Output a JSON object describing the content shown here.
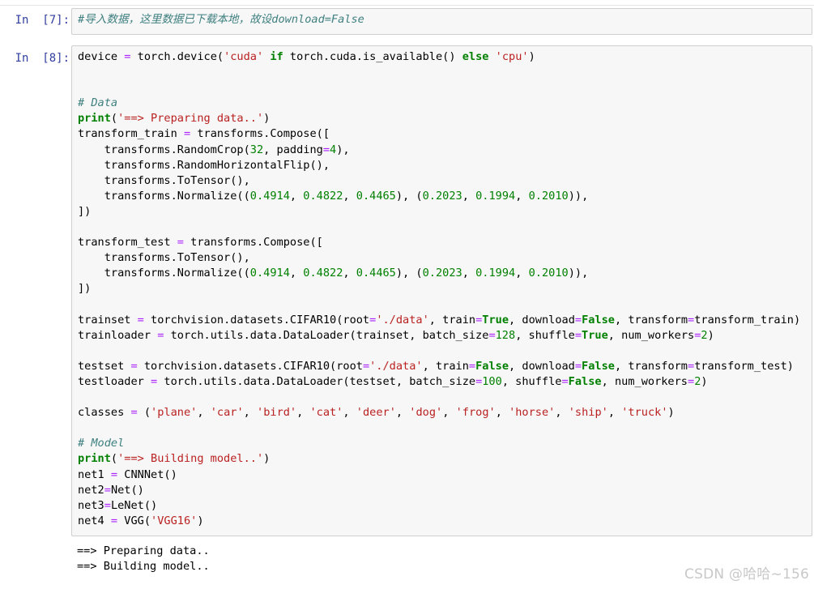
{
  "cells": [
    {
      "prompt": "In  [7]:",
      "lines": [
        [
          {
            "t": "#导入数据，这里数据已下载本地，故设download=False",
            "c": "com"
          }
        ]
      ]
    },
    {
      "prompt": "In  [8]:",
      "lines": [
        [
          {
            "t": "device ",
            "c": "plain"
          },
          {
            "t": "=",
            "c": "op"
          },
          {
            "t": " torch.device(",
            "c": "plain"
          },
          {
            "t": "'cuda'",
            "c": "str"
          },
          {
            "t": " ",
            "c": "plain"
          },
          {
            "t": "if",
            "c": "kw"
          },
          {
            "t": " torch.cuda.is_available() ",
            "c": "plain"
          },
          {
            "t": "else",
            "c": "kw"
          },
          {
            "t": " ",
            "c": "plain"
          },
          {
            "t": "'cpu'",
            "c": "str"
          },
          {
            "t": ")",
            "c": "plain"
          }
        ],
        [],
        [],
        [
          {
            "t": "# Data",
            "c": "com"
          }
        ],
        [
          {
            "t": "print",
            "c": "kw"
          },
          {
            "t": "(",
            "c": "plain"
          },
          {
            "t": "'==> Preparing data..'",
            "c": "str"
          },
          {
            "t": ")",
            "c": "plain"
          }
        ],
        [
          {
            "t": "transform_train ",
            "c": "plain"
          },
          {
            "t": "=",
            "c": "op"
          },
          {
            "t": " transforms.Compose([",
            "c": "plain"
          }
        ],
        [
          {
            "t": "    transforms.RandomCrop(",
            "c": "plain"
          },
          {
            "t": "32",
            "c": "num"
          },
          {
            "t": ", padding",
            "c": "plain"
          },
          {
            "t": "=",
            "c": "op"
          },
          {
            "t": "4",
            "c": "num"
          },
          {
            "t": "),",
            "c": "plain"
          }
        ],
        [
          {
            "t": "    transforms.RandomHorizontalFlip(),",
            "c": "plain"
          }
        ],
        [
          {
            "t": "    transforms.ToTensor(),",
            "c": "plain"
          }
        ],
        [
          {
            "t": "    transforms.Normalize((",
            "c": "plain"
          },
          {
            "t": "0.4914",
            "c": "num"
          },
          {
            "t": ", ",
            "c": "plain"
          },
          {
            "t": "0.4822",
            "c": "num"
          },
          {
            "t": ", ",
            "c": "plain"
          },
          {
            "t": "0.4465",
            "c": "num"
          },
          {
            "t": "), (",
            "c": "plain"
          },
          {
            "t": "0.2023",
            "c": "num"
          },
          {
            "t": ", ",
            "c": "plain"
          },
          {
            "t": "0.1994",
            "c": "num"
          },
          {
            "t": ", ",
            "c": "plain"
          },
          {
            "t": "0.2010",
            "c": "num"
          },
          {
            "t": ")),",
            "c": "plain"
          }
        ],
        [
          {
            "t": "])",
            "c": "plain"
          }
        ],
        [],
        [
          {
            "t": "transform_test ",
            "c": "plain"
          },
          {
            "t": "=",
            "c": "op"
          },
          {
            "t": " transforms.Compose([",
            "c": "plain"
          }
        ],
        [
          {
            "t": "    transforms.ToTensor(),",
            "c": "plain"
          }
        ],
        [
          {
            "t": "    transforms.Normalize((",
            "c": "plain"
          },
          {
            "t": "0.4914",
            "c": "num"
          },
          {
            "t": ", ",
            "c": "plain"
          },
          {
            "t": "0.4822",
            "c": "num"
          },
          {
            "t": ", ",
            "c": "plain"
          },
          {
            "t": "0.4465",
            "c": "num"
          },
          {
            "t": "), (",
            "c": "plain"
          },
          {
            "t": "0.2023",
            "c": "num"
          },
          {
            "t": ", ",
            "c": "plain"
          },
          {
            "t": "0.1994",
            "c": "num"
          },
          {
            "t": ", ",
            "c": "plain"
          },
          {
            "t": "0.2010",
            "c": "num"
          },
          {
            "t": ")),",
            "c": "plain"
          }
        ],
        [
          {
            "t": "])",
            "c": "plain"
          }
        ],
        [],
        [
          {
            "t": "trainset ",
            "c": "plain"
          },
          {
            "t": "=",
            "c": "op"
          },
          {
            "t": " torchvision.datasets.CIFAR10(root",
            "c": "plain"
          },
          {
            "t": "=",
            "c": "op"
          },
          {
            "t": "'./data'",
            "c": "str"
          },
          {
            "t": ", train",
            "c": "plain"
          },
          {
            "t": "=",
            "c": "op"
          },
          {
            "t": "True",
            "c": "kw"
          },
          {
            "t": ", download",
            "c": "plain"
          },
          {
            "t": "=",
            "c": "op"
          },
          {
            "t": "False",
            "c": "kw"
          },
          {
            "t": ", transform",
            "c": "plain"
          },
          {
            "t": "=",
            "c": "op"
          },
          {
            "t": "transform_train)",
            "c": "plain"
          }
        ],
        [
          {
            "t": "trainloader ",
            "c": "plain"
          },
          {
            "t": "=",
            "c": "op"
          },
          {
            "t": " torch.utils.data.DataLoader(trainset, batch_size",
            "c": "plain"
          },
          {
            "t": "=",
            "c": "op"
          },
          {
            "t": "128",
            "c": "num"
          },
          {
            "t": ", shuffle",
            "c": "plain"
          },
          {
            "t": "=",
            "c": "op"
          },
          {
            "t": "True",
            "c": "kw"
          },
          {
            "t": ", num_workers",
            "c": "plain"
          },
          {
            "t": "=",
            "c": "op"
          },
          {
            "t": "2",
            "c": "num"
          },
          {
            "t": ")",
            "c": "plain"
          }
        ],
        [],
        [
          {
            "t": "testset ",
            "c": "plain"
          },
          {
            "t": "=",
            "c": "op"
          },
          {
            "t": " torchvision.datasets.CIFAR10(root",
            "c": "plain"
          },
          {
            "t": "=",
            "c": "op"
          },
          {
            "t": "'./data'",
            "c": "str"
          },
          {
            "t": ", train",
            "c": "plain"
          },
          {
            "t": "=",
            "c": "op"
          },
          {
            "t": "False",
            "c": "kw"
          },
          {
            "t": ", download",
            "c": "plain"
          },
          {
            "t": "=",
            "c": "op"
          },
          {
            "t": "False",
            "c": "kw"
          },
          {
            "t": ", transform",
            "c": "plain"
          },
          {
            "t": "=",
            "c": "op"
          },
          {
            "t": "transform_test)",
            "c": "plain"
          }
        ],
        [
          {
            "t": "testloader ",
            "c": "plain"
          },
          {
            "t": "=",
            "c": "op"
          },
          {
            "t": " torch.utils.data.DataLoader(testset, batch_size",
            "c": "plain"
          },
          {
            "t": "=",
            "c": "op"
          },
          {
            "t": "100",
            "c": "num"
          },
          {
            "t": ", shuffle",
            "c": "plain"
          },
          {
            "t": "=",
            "c": "op"
          },
          {
            "t": "False",
            "c": "kw"
          },
          {
            "t": ", num_workers",
            "c": "plain"
          },
          {
            "t": "=",
            "c": "op"
          },
          {
            "t": "2",
            "c": "num"
          },
          {
            "t": ")",
            "c": "plain"
          }
        ],
        [],
        [
          {
            "t": "classes ",
            "c": "plain"
          },
          {
            "t": "=",
            "c": "op"
          },
          {
            "t": " (",
            "c": "plain"
          },
          {
            "t": "'plane'",
            "c": "str"
          },
          {
            "t": ", ",
            "c": "plain"
          },
          {
            "t": "'car'",
            "c": "str"
          },
          {
            "t": ", ",
            "c": "plain"
          },
          {
            "t": "'bird'",
            "c": "str"
          },
          {
            "t": ", ",
            "c": "plain"
          },
          {
            "t": "'cat'",
            "c": "str"
          },
          {
            "t": ", ",
            "c": "plain"
          },
          {
            "t": "'deer'",
            "c": "str"
          },
          {
            "t": ", ",
            "c": "plain"
          },
          {
            "t": "'dog'",
            "c": "str"
          },
          {
            "t": ", ",
            "c": "plain"
          },
          {
            "t": "'frog'",
            "c": "str"
          },
          {
            "t": ", ",
            "c": "plain"
          },
          {
            "t": "'horse'",
            "c": "str"
          },
          {
            "t": ", ",
            "c": "plain"
          },
          {
            "t": "'ship'",
            "c": "str"
          },
          {
            "t": ", ",
            "c": "plain"
          },
          {
            "t": "'truck'",
            "c": "str"
          },
          {
            "t": ")",
            "c": "plain"
          }
        ],
        [],
        [
          {
            "t": "# Model",
            "c": "com"
          }
        ],
        [
          {
            "t": "print",
            "c": "kw"
          },
          {
            "t": "(",
            "c": "plain"
          },
          {
            "t": "'==> Building model..'",
            "c": "str"
          },
          {
            "t": ")",
            "c": "plain"
          }
        ],
        [
          {
            "t": "net1 ",
            "c": "plain"
          },
          {
            "t": "=",
            "c": "op"
          },
          {
            "t": " CNNNet()",
            "c": "plain"
          }
        ],
        [
          {
            "t": "net2",
            "c": "plain"
          },
          {
            "t": "=",
            "c": "op"
          },
          {
            "t": "Net()",
            "c": "plain"
          }
        ],
        [
          {
            "t": "net3",
            "c": "plain"
          },
          {
            "t": "=",
            "c": "op"
          },
          {
            "t": "LeNet()",
            "c": "plain"
          }
        ],
        [
          {
            "t": "net4 ",
            "c": "plain"
          },
          {
            "t": "=",
            "c": "op"
          },
          {
            "t": " VGG(",
            "c": "plain"
          },
          {
            "t": "'VGG16'",
            "c": "str"
          },
          {
            "t": ")",
            "c": "plain"
          }
        ]
      ],
      "outputs": [
        "==> Preparing data..",
        "==> Building model.."
      ]
    }
  ],
  "watermark": "CSDN @哈哈~156"
}
